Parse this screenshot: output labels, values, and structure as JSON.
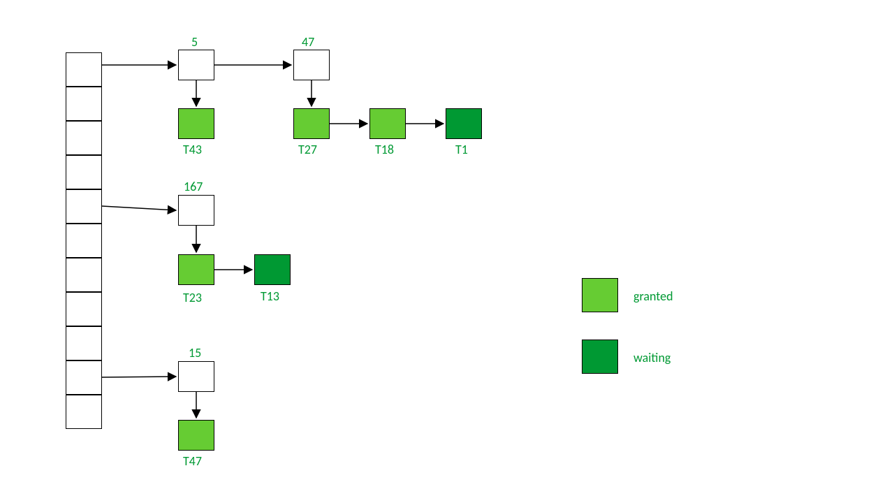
{
  "colors": {
    "granted": "#66cc33",
    "waiting": "#009933",
    "label": "#009933",
    "border": "#000000"
  },
  "legend": {
    "granted_label": "granted",
    "waiting_label": "waiting"
  },
  "hashRows": 11,
  "buckets": [
    {
      "key": "5",
      "chain": [
        {
          "id": "T43",
          "state": "granted"
        }
      ],
      "next": {
        "key": "47",
        "chain": [
          {
            "id": "T27",
            "state": "granted"
          },
          {
            "id": "T18",
            "state": "granted"
          },
          {
            "id": "T1",
            "state": "waiting"
          }
        ]
      }
    },
    {
      "key": "167",
      "chain": [
        {
          "id": "T23",
          "state": "granted"
        },
        {
          "id": "T13",
          "state": "waiting"
        }
      ]
    },
    {
      "key": "15",
      "chain": [
        {
          "id": "T47",
          "state": "granted"
        }
      ]
    }
  ]
}
